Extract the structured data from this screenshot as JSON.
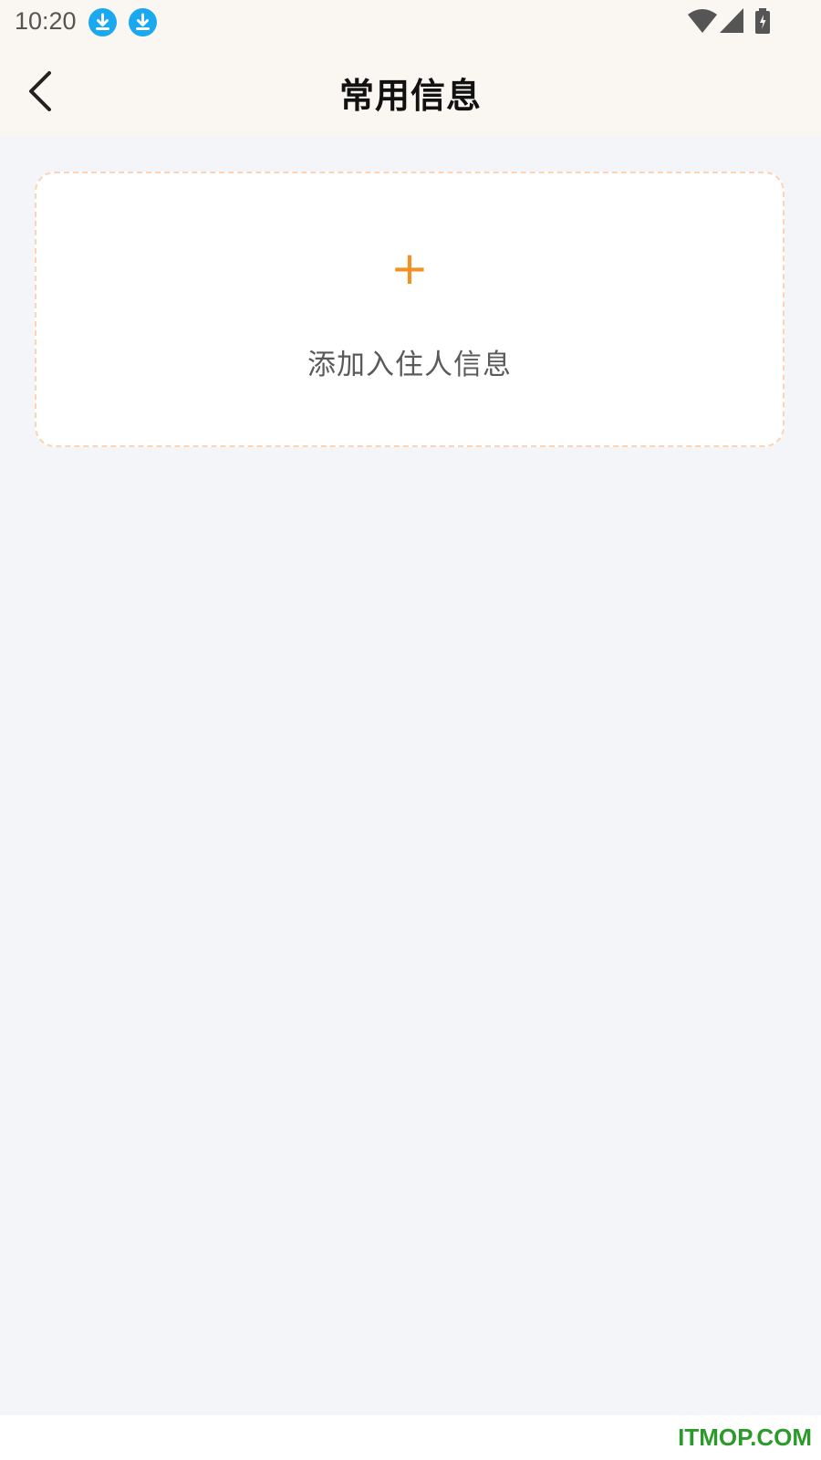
{
  "status_bar": {
    "time": "10:20",
    "icons": [
      "download-icon",
      "download-icon",
      "wifi-icon",
      "signal-icon",
      "battery-charging-icon"
    ]
  },
  "nav": {
    "back_icon": "chevron-left-icon",
    "title": "常用信息"
  },
  "add_card": {
    "plus": "+",
    "label": "添加入住人信息",
    "accent_color": "#f39221",
    "border_color": "#fdd4b3"
  },
  "watermark": "ITMOP.COM",
  "colors": {
    "header_bg": "#faf6f1",
    "page_bg": "#f4f5f9",
    "download_badge": "#1aa9f0"
  }
}
